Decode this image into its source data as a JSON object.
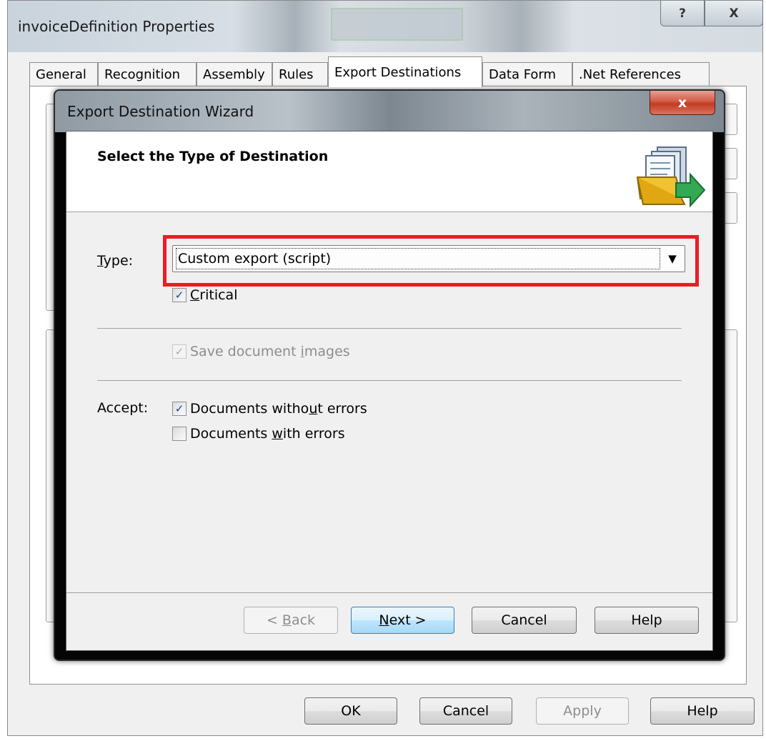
{
  "outer_window": {
    "title": "invoiceDefinition Properties",
    "help_button": "?",
    "close_button": "X",
    "tabs": [
      {
        "label": "General"
      },
      {
        "label": "Recognition"
      },
      {
        "label": "Assembly"
      },
      {
        "label": "Rules"
      },
      {
        "label": "Export Destinations"
      },
      {
        "label": "Data Form"
      },
      {
        "label": ".Net References"
      }
    ],
    "active_tab": "Export Destinations",
    "buttons": {
      "ok": "OK",
      "cancel": "Cancel",
      "apply": "Apply",
      "help": "Help"
    }
  },
  "wizard": {
    "title": "Export Destination Wizard",
    "close_button": "x",
    "heading": "Select the Type of Destination",
    "type_label": {
      "underlined": "T",
      "rest": "ype:"
    },
    "type_value": "Custom export (script)",
    "critical": {
      "checked": true,
      "underlined": "C",
      "rest": "ritical"
    },
    "save_images": {
      "checked": true,
      "enabled": false,
      "before": "Save document ",
      "underlined": "i",
      "after": "mages"
    },
    "accept_label": "Accept:",
    "docs_without_errors": {
      "checked": true,
      "before": "Documents witho",
      "underlined": "u",
      "after": "t errors"
    },
    "docs_with_errors": {
      "checked": false,
      "before": "Documents ",
      "underlined": "w",
      "after": "ith errors"
    },
    "buttons": {
      "back": {
        "before": "< ",
        "underlined": "B",
        "after": "ack"
      },
      "next": {
        "underlined": "N",
        "after": "ext >"
      },
      "cancel": "Cancel",
      "help": "Help"
    },
    "accent_colors": {
      "highlight": "#ec1c24",
      "checkmark": "#1b3f91",
      "close": "#c23b22"
    }
  }
}
